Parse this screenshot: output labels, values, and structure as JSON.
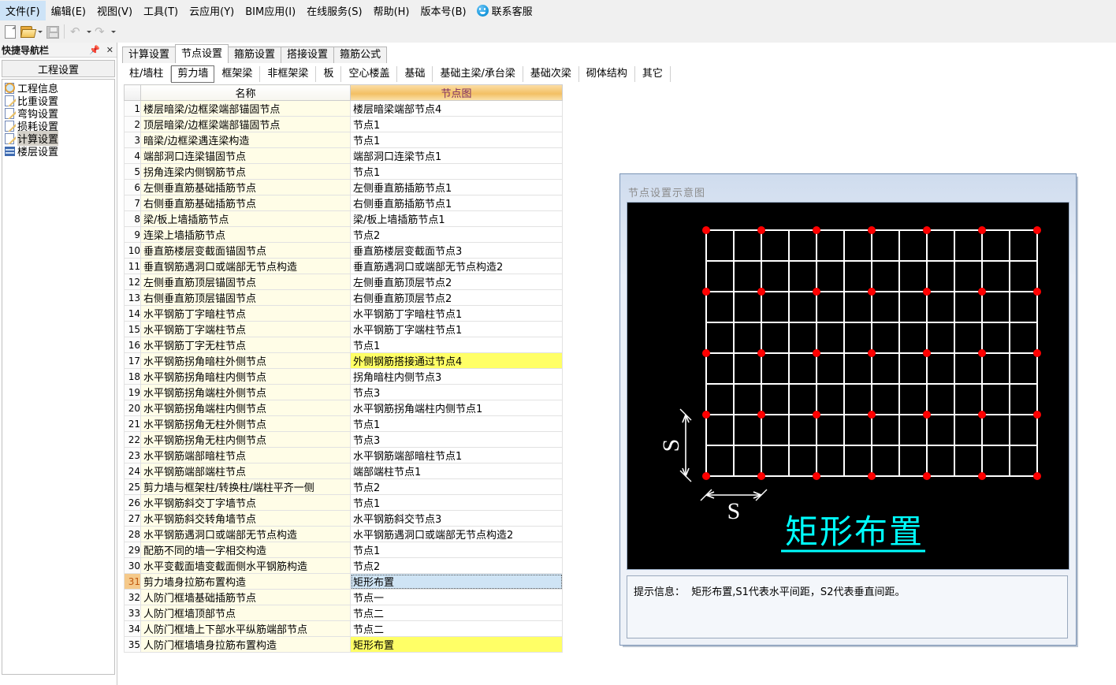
{
  "menu": {
    "items": [
      "文件(F)",
      "编辑(E)",
      "视图(V)",
      "工具(T)",
      "云应用(Y)",
      "BIM应用(I)",
      "在线服务(S)",
      "帮助(H)",
      "版本号(B)"
    ],
    "service_label": "联系客服",
    "service_icon": "smiley-face-icon"
  },
  "toolbar": {
    "items": [
      {
        "name": "new-document-icon",
        "enabled": true
      },
      {
        "name": "open-folder-icon",
        "enabled": true
      },
      {
        "name": "save-icon",
        "enabled": false
      },
      {
        "name": "undo-icon",
        "enabled": false
      },
      {
        "name": "redo-icon",
        "enabled": false
      }
    ]
  },
  "sidebar": {
    "title": "快捷导航栏",
    "pin_icon": "pin-icon",
    "close_icon": "close-icon",
    "section": "工程设置",
    "items": [
      {
        "label": "工程信息",
        "icon": "magnifier-icon",
        "selected": false
      },
      {
        "label": "比重设置",
        "icon": "pencil-icon",
        "selected": false
      },
      {
        "label": "弯钩设置",
        "icon": "pencil-icon",
        "selected": false
      },
      {
        "label": "损耗设置",
        "icon": "pencil-icon",
        "selected": false
      },
      {
        "label": "计算设置",
        "icon": "pencil-icon",
        "selected": true
      },
      {
        "label": "楼层设置",
        "icon": "stair-icon",
        "selected": false
      }
    ]
  },
  "tabs": [
    {
      "label": "计算设置",
      "active": false
    },
    {
      "label": "节点设置",
      "active": true
    },
    {
      "label": "箍筋设置",
      "active": false
    },
    {
      "label": "搭接设置",
      "active": false
    },
    {
      "label": "箍筋公式",
      "active": false
    }
  ],
  "subtabs": [
    {
      "label": "柱/墙柱",
      "active": false
    },
    {
      "label": "剪力墙",
      "active": true
    },
    {
      "label": "框架梁",
      "active": false
    },
    {
      "label": "非框架梁",
      "active": false
    },
    {
      "label": "板",
      "active": false
    },
    {
      "label": "空心楼盖",
      "active": false
    },
    {
      "label": "基础",
      "active": false
    },
    {
      "label": "基础主梁/承台梁",
      "active": false
    },
    {
      "label": "基础次梁",
      "active": false
    },
    {
      "label": "砌体结构",
      "active": false
    },
    {
      "label": "其它",
      "active": false
    }
  ],
  "table": {
    "columns": [
      "",
      "名称",
      "节点图"
    ],
    "rows": [
      {
        "n": "1",
        "name": "楼层暗梁/边框梁端部锚固节点",
        "value": "楼层暗梁端部节点4",
        "state": "normal"
      },
      {
        "n": "2",
        "name": "顶层暗梁/边框梁端部锚固节点",
        "value": "节点1",
        "state": "normal"
      },
      {
        "n": "3",
        "name": "暗梁/边框梁遇连梁构造",
        "value": "节点1",
        "state": "normal"
      },
      {
        "n": "4",
        "name": "端部洞口连梁锚固节点",
        "value": "端部洞口连梁节点1",
        "state": "normal"
      },
      {
        "n": "5",
        "name": "拐角连梁内侧钢筋节点",
        "value": "节点1",
        "state": "normal"
      },
      {
        "n": "6",
        "name": "左侧垂直筋基础插筋节点",
        "value": "左侧垂直筋插筋节点1",
        "state": "normal"
      },
      {
        "n": "7",
        "name": "右侧垂直筋基础插筋节点",
        "value": "右侧垂直筋插筋节点1",
        "state": "normal"
      },
      {
        "n": "8",
        "name": "梁/板上墙插筋节点",
        "value": "梁/板上墙插筋节点1",
        "state": "normal"
      },
      {
        "n": "9",
        "name": "连梁上墙插筋节点",
        "value": "节点2",
        "state": "normal"
      },
      {
        "n": "10",
        "name": "垂直筋楼层变截面锚固节点",
        "value": "垂直筋楼层变截面节点3",
        "state": "normal"
      },
      {
        "n": "11",
        "name": "垂直钢筋遇洞口或端部无节点构造",
        "value": "垂直筋遇洞口或端部无节点构造2",
        "state": "normal"
      },
      {
        "n": "12",
        "name": "左侧垂直筋顶层锚固节点",
        "value": "左侧垂直筋顶层节点2",
        "state": "normal"
      },
      {
        "n": "13",
        "name": "右侧垂直筋顶层锚固节点",
        "value": "右侧垂直筋顶层节点2",
        "state": "normal"
      },
      {
        "n": "14",
        "name": "水平钢筋丁字暗柱节点",
        "value": "水平钢筋丁字暗柱节点1",
        "state": "normal"
      },
      {
        "n": "15",
        "name": "水平钢筋丁字端柱节点",
        "value": "水平钢筋丁字端柱节点1",
        "state": "normal"
      },
      {
        "n": "16",
        "name": "水平钢筋丁字无柱节点",
        "value": "节点1",
        "state": "normal"
      },
      {
        "n": "17",
        "name": "水平钢筋拐角暗柱外侧节点",
        "value": "外侧钢筋搭接通过节点4",
        "state": "highlight"
      },
      {
        "n": "18",
        "name": "水平钢筋拐角暗柱内侧节点",
        "value": "拐角暗柱内侧节点3",
        "state": "normal"
      },
      {
        "n": "19",
        "name": "水平钢筋拐角端柱外侧节点",
        "value": "节点3",
        "state": "normal"
      },
      {
        "n": "20",
        "name": "水平钢筋拐角端柱内侧节点",
        "value": "水平钢筋拐角端柱内侧节点1",
        "state": "normal"
      },
      {
        "n": "21",
        "name": "水平钢筋拐角无柱外侧节点",
        "value": "节点1",
        "state": "normal"
      },
      {
        "n": "22",
        "name": "水平钢筋拐角无柱内侧节点",
        "value": "节点3",
        "state": "normal"
      },
      {
        "n": "23",
        "name": "水平钢筋端部暗柱节点",
        "value": "水平钢筋端部暗柱节点1",
        "state": "normal"
      },
      {
        "n": "24",
        "name": "水平钢筋端部端柱节点",
        "value": "端部端柱节点1",
        "state": "normal"
      },
      {
        "n": "25",
        "name": "剪力墙与框架柱/转换柱/端柱平齐一侧",
        "value": "节点2",
        "state": "normal"
      },
      {
        "n": "26",
        "name": "水平钢筋斜交丁字墙节点",
        "value": "节点1",
        "state": "normal"
      },
      {
        "n": "27",
        "name": "水平钢筋斜交转角墙节点",
        "value": "水平钢筋斜交节点3",
        "state": "normal"
      },
      {
        "n": "28",
        "name": "水平钢筋遇洞口或端部无节点构造",
        "value": "水平钢筋遇洞口或端部无节点构造2",
        "state": "normal"
      },
      {
        "n": "29",
        "name": "配筋不同的墙一字相交构造",
        "value": "节点1",
        "state": "normal"
      },
      {
        "n": "30",
        "name": "水平变截面墙变截面侧水平钢筋构造",
        "value": "节点2",
        "state": "normal"
      },
      {
        "n": "31",
        "name": "剪力墙身拉筋布置构造",
        "value": "矩形布置",
        "state": "selected"
      },
      {
        "n": "32",
        "name": "人防门框墙基础插筋节点",
        "value": "节点一",
        "state": "normal"
      },
      {
        "n": "33",
        "name": "人防门框墙顶部节点",
        "value": "节点二",
        "state": "normal"
      },
      {
        "n": "34",
        "name": "人防门框墙上下部水平纵筋端部节点",
        "value": "节点二",
        "state": "normal"
      },
      {
        "n": "35",
        "name": "人防门框墙墙身拉筋布置构造",
        "value": "矩形布置",
        "state": "highlight"
      }
    ]
  },
  "diagram": {
    "title": "节点设置示意图",
    "caption": "矩形布置",
    "dim_vertical_label": "S",
    "dim_horizontal_label": "S",
    "tip_prefix": "提示信息：",
    "tip_text": "矩形布置,S1代表水平间距，S2代表垂直间距。",
    "colors": {
      "grid_line": "#ffffff",
      "node_dot": "#ff0000",
      "caption": "#00ffff",
      "background": "#000000"
    },
    "grid": {
      "cols": 12,
      "rows": 8,
      "dot_step_x": 2,
      "dot_step_y": 2
    }
  }
}
